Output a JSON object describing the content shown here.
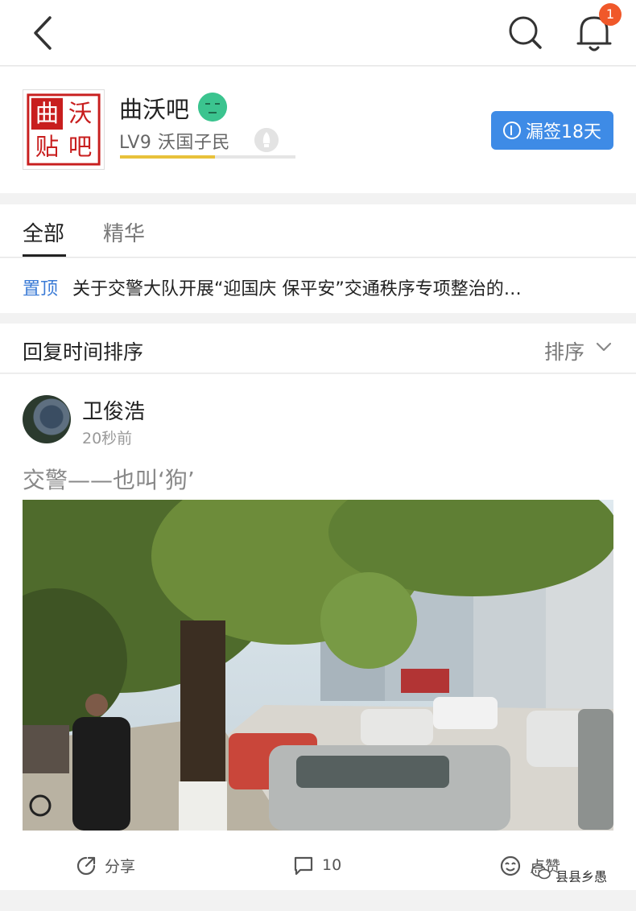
{
  "topbar": {
    "notification_count": "1"
  },
  "forum": {
    "name": "曲沃吧",
    "logo_chars": [
      "曲",
      "沃",
      "贴",
      "吧"
    ],
    "level": "LV9",
    "level_title": "沃国子民",
    "level_progress": 0.54,
    "sign_label": "漏签18天"
  },
  "tabs": [
    "全部",
    "精华"
  ],
  "pinned": {
    "tag": "置顶",
    "title": "关于交警大队开展“迎国庆 保平安”交通秩序专项整治的…"
  },
  "sort": {
    "label": "回复时间排序",
    "button": "排序"
  },
  "post": {
    "username": "卫俊浩",
    "time": "20秒前",
    "text": "交警——也叫‘狗’",
    "actions": {
      "share": "分享",
      "comments": "10",
      "like": "点赞"
    }
  },
  "watermark": "县县乡愚",
  "colors": {
    "accent_blue": "#3e8be6",
    "badge": "#f0582a",
    "pin_blue": "#3b7bd6",
    "level_bar": "#e8c13a"
  }
}
